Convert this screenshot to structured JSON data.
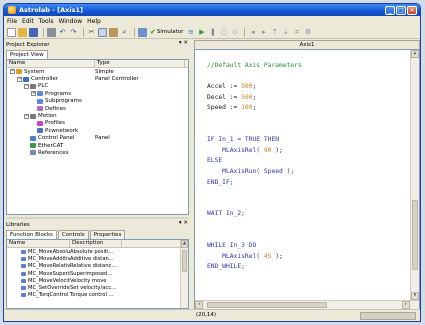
{
  "window": {
    "title": "Astrolab - [Axis1]"
  },
  "menu": [
    "File",
    "Edit",
    "Tools",
    "Window",
    "Help"
  ],
  "toolbar": {
    "simulator_label": "Simulator"
  },
  "project_explorer": {
    "title": "Project Explorer",
    "pin": "▾ ✕",
    "tab": "Project View",
    "col_name": "Name",
    "col_type": "Type",
    "items": [
      {
        "label": "System",
        "type": "Simple",
        "depth": 0,
        "expander": "−",
        "icon_color": "#d8a02a"
      },
      {
        "label": "Controller",
        "type": "Panel Controller",
        "depth": 1,
        "expander": "−",
        "icon_color": "#3c6fbf"
      },
      {
        "label": "PLC",
        "type": "",
        "depth": 2,
        "expander": "−",
        "icon_color": "#7a7a7a"
      },
      {
        "label": "Programs",
        "type": "",
        "depth": 3,
        "expander": "+",
        "icon_color": "#5c8ad6"
      },
      {
        "label": "Subprograms",
        "type": "",
        "depth": 3,
        "expander": "",
        "icon_color": "#5c8ad6"
      },
      {
        "label": "Defines",
        "type": "",
        "depth": 3,
        "expander": "",
        "icon_color": "#b86bc4"
      },
      {
        "label": "Motion",
        "type": "",
        "depth": 2,
        "expander": "−",
        "icon_color": "#7a7a7a"
      },
      {
        "label": "Profiles",
        "type": "",
        "depth": 3,
        "expander": "",
        "icon_color": "#c04ac9"
      },
      {
        "label": "Pcwnetwork",
        "type": "",
        "depth": 3,
        "expander": "",
        "icon_color": "#4d6fc4"
      },
      {
        "label": "Control Panel",
        "type": "Panel",
        "depth": 2,
        "expander": "",
        "icon_color": "#4f7fcf"
      },
      {
        "label": "EtherCAT",
        "type": "",
        "depth": 2,
        "expander": "",
        "icon_color": "#3b9a4a"
      },
      {
        "label": "References",
        "type": "",
        "depth": 2,
        "expander": "",
        "icon_color": "#7b87b0"
      }
    ]
  },
  "libraries": {
    "title": "Libraries",
    "pin": "▾ ✕",
    "tabs": [
      "Function Blocks",
      "Controls",
      "Properties"
    ],
    "col_name": "Name",
    "col_desc": "Description",
    "items": [
      {
        "name": "MC_MoveAbsolute",
        "desc": "Absolute positi..."
      },
      {
        "name": "MC_MoveAdditive",
        "desc": "Additive distan..."
      },
      {
        "name": "MC_MoveRelative",
        "desc": "Relative distanc..."
      },
      {
        "name": "MC_MoveSuperimp",
        "desc": "Superimposed..."
      },
      {
        "name": "MC_MoveVelocity",
        "desc": "Velocity move"
      },
      {
        "name": "MC_SetOverride",
        "desc": "Set velocity/acc..."
      },
      {
        "name": "MC_TorqControl",
        "desc": "Torque control ..."
      }
    ]
  },
  "editor": {
    "tab": "Axis1",
    "lines": [
      {
        "line": 1,
        "parts": [
          {
            "t": "//Default Axis Parameters",
            "c": "comment"
          }
        ]
      },
      {
        "line": 3,
        "parts": [
          {
            "t": "Accel := ",
            "c": "id"
          },
          {
            "t": "500",
            "c": "num"
          },
          {
            "t": ";",
            "c": "id"
          }
        ]
      },
      {
        "line": 4,
        "parts": [
          {
            "t": "Decel := ",
            "c": "id"
          },
          {
            "t": "500",
            "c": "num"
          },
          {
            "t": ";",
            "c": "id"
          }
        ]
      },
      {
        "line": 5,
        "parts": [
          {
            "t": "Speed := ",
            "c": "id"
          },
          {
            "t": "100",
            "c": "num"
          },
          {
            "t": ";",
            "c": "id"
          }
        ]
      },
      {
        "line": 8,
        "parts": [
          {
            "t": "IF In_1 = TRUE THEN",
            "c": "kw"
          }
        ]
      },
      {
        "line": 9,
        "parts": [
          {
            "t": "    MLAxisRel( ",
            "c": "kw"
          },
          {
            "t": "90",
            "c": "num"
          },
          {
            "t": " );",
            "c": "id"
          }
        ]
      },
      {
        "line": 10,
        "parts": [
          {
            "t": "ELSE",
            "c": "kw"
          }
        ]
      },
      {
        "line": 11,
        "parts": [
          {
            "t": "    MLAxisRun( Speed );",
            "c": "kw"
          }
        ]
      },
      {
        "line": 12,
        "parts": [
          {
            "t": "END_IF;",
            "c": "kw"
          }
        ]
      },
      {
        "line": 15,
        "parts": [
          {
            "t": "WAIT In_2;",
            "c": "kw"
          }
        ]
      },
      {
        "line": 18,
        "parts": [
          {
            "t": "WHILE In_3 DO",
            "c": "kw"
          }
        ]
      },
      {
        "line": 19,
        "parts": [
          {
            "t": "    MLAxisRel( ",
            "c": "kw"
          },
          {
            "t": "45",
            "c": "num"
          },
          {
            "t": " );",
            "c": "id"
          }
        ]
      },
      {
        "line": 20,
        "parts": [
          {
            "t": "END_WHILE;",
            "c": "kw"
          }
        ]
      }
    ]
  },
  "status": {
    "position": "(20,14)"
  }
}
